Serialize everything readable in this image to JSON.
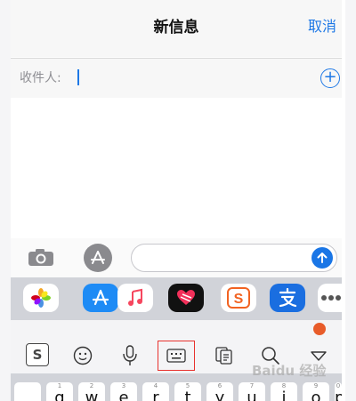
{
  "header": {
    "title": "新信息",
    "cancel_label": "取消"
  },
  "recipient": {
    "label": "收件人:",
    "value": ""
  },
  "compose": {
    "placeholder": ""
  },
  "app_drawer": {
    "apps": [
      "photos-icon",
      "app-store-icon",
      "music-icon",
      "digital-touch-icon",
      "sogou-icon",
      "alipay-icon",
      "more-icon"
    ]
  },
  "ime_toolbar": {
    "items": [
      "sogou-logo-icon",
      "emoji-icon",
      "microphone-icon",
      "keyboard-icon",
      "clipboard-icon",
      "search-icon",
      "collapse-icon"
    ],
    "logo_text": "S"
  },
  "keyboard": {
    "keys": [
      {
        "digit": "1",
        "letter": "q"
      },
      {
        "digit": "2",
        "letter": "w"
      },
      {
        "digit": "3",
        "letter": "e"
      },
      {
        "digit": "4",
        "letter": "r"
      },
      {
        "digit": "5",
        "letter": "t"
      },
      {
        "digit": "6",
        "letter": "y"
      },
      {
        "digit": "7",
        "letter": "u"
      },
      {
        "digit": "8",
        "letter": "i"
      },
      {
        "digit": "9",
        "letter": "o"
      },
      {
        "digit": "0",
        "letter": "p"
      }
    ]
  },
  "watermark": {
    "text": "Baidu 经验"
  },
  "colors": {
    "accent": "#1e78e6",
    "highlight_box": "#e8322e"
  }
}
